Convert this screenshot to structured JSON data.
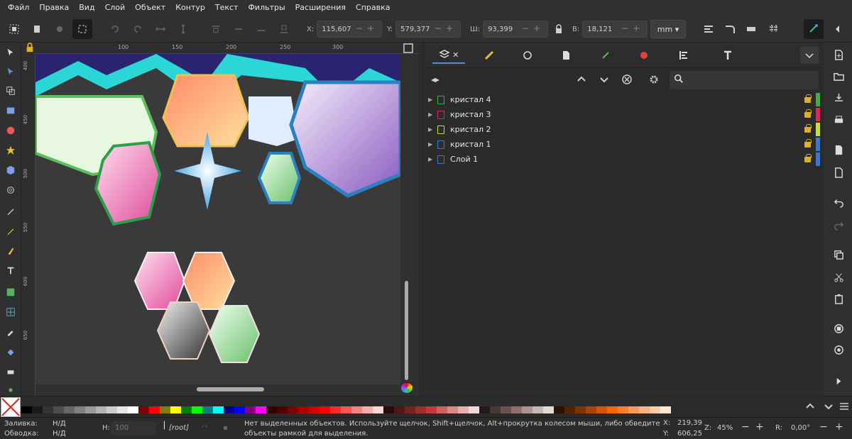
{
  "menu": [
    "Файл",
    "Правка",
    "Вид",
    "Слой",
    "Объект",
    "Контур",
    "Текст",
    "Фильтры",
    "Расширения",
    "Справка"
  ],
  "toolbar": {
    "x_label": "X:",
    "x_value": "115,607",
    "y_label": "Y:",
    "y_value": "579,377",
    "w_label": "Ш:",
    "w_value": "93,399",
    "h_label": "В:",
    "h_value": "18,121",
    "unit": "mm"
  },
  "ruler": {
    "top": [
      "100",
      "150",
      "200",
      "250",
      "300"
    ],
    "left": [
      "400",
      "450",
      "500",
      "550",
      "600",
      "650"
    ]
  },
  "layers": [
    {
      "name": "кристал 4",
      "color": "#3cb043"
    },
    {
      "name": "кристал 3",
      "color": "#e0245e"
    },
    {
      "name": "кристал 2",
      "color": "#c8e030"
    },
    {
      "name": "кристал 1",
      "color": "#3a78d8"
    },
    {
      "name": "Слой 1",
      "color": "#3a78d8"
    }
  ],
  "palette": [
    "#000000",
    "#1a1a1a",
    "#333333",
    "#4d4d4d",
    "#666666",
    "#808080",
    "#999999",
    "#b3b3b3",
    "#cccccc",
    "#e6e6e6",
    "#ffffff",
    "#800000",
    "#ff0000",
    "#808000",
    "#ffff00",
    "#008000",
    "#00ff00",
    "#008080",
    "#00ffff",
    "#000080",
    "#0000ff",
    "#800080",
    "#ff00ff",
    "#2b0000",
    "#550000",
    "#800000",
    "#aa0000",
    "#d40000",
    "#ff0000",
    "#ff2a2a",
    "#ff5555",
    "#ff8080",
    "#ffaaaa",
    "#ffd5d5",
    "#280b0b",
    "#501616",
    "#782121",
    "#a02c2c",
    "#c83737",
    "#d35f5f",
    "#de8787",
    "#e9afaf",
    "#f4d7d7",
    "#241c1c",
    "#483737",
    "#6c5353",
    "#916f6f",
    "#ac9393",
    "#c8b7b7",
    "#e3dbdb",
    "#2b1100",
    "#552200",
    "#803300",
    "#aa4400",
    "#d45500",
    "#ff6600",
    "#ff7f2a",
    "#ff9955",
    "#ffb380",
    "#ffccaa",
    "#ffe6d5"
  ],
  "status": {
    "fill_label": "Заливка:",
    "fill_value": "Н/Д",
    "stroke_label": "Обводка:",
    "stroke_value": "Н/Д",
    "h_label": "Н:",
    "h_value": "100",
    "layer": "[root]",
    "message": "Нет выделенных объектов. Используйте щелчок, Shift+щелчок, Alt+прокрутка колесом мыши, либо обведите объекты рамкой для выделения.",
    "cx_label": "X:",
    "cx_value": "219,39",
    "cy_label": "Y:",
    "cy_value": "606,25",
    "zoom_label": "Z:",
    "zoom_value": "45%",
    "rot_label": "R:",
    "rot_value": "0,00°"
  }
}
